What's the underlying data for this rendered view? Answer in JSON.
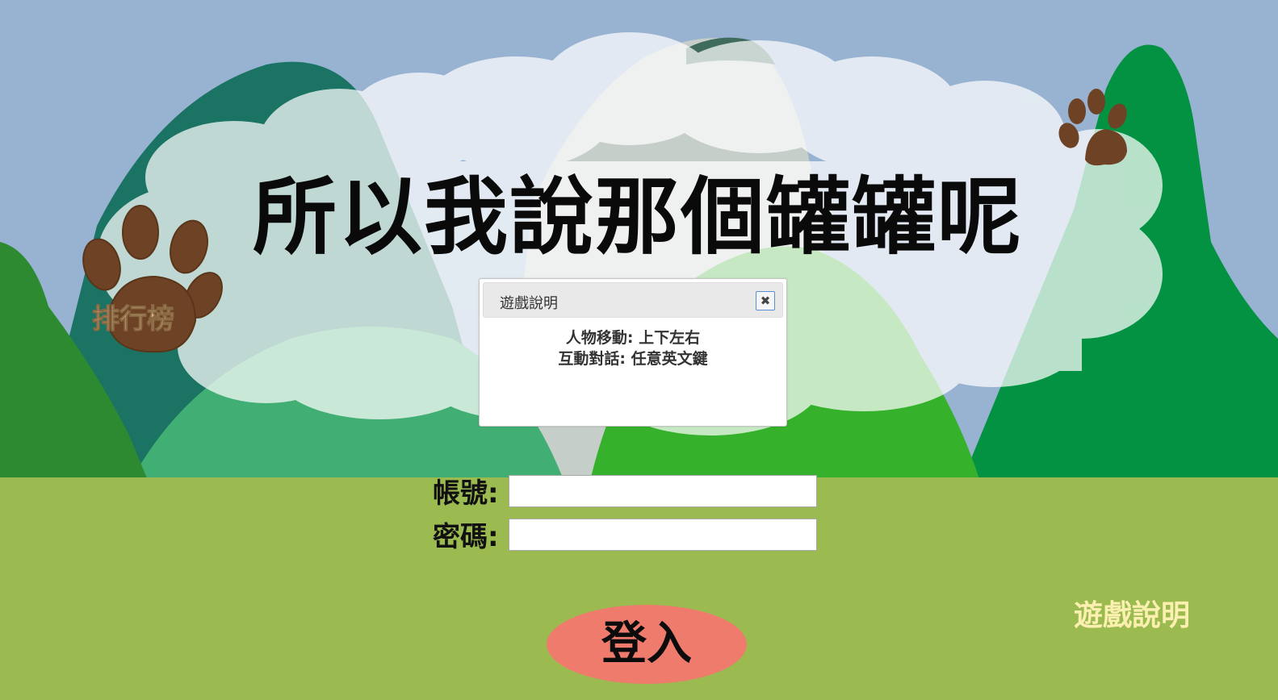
{
  "page": {
    "title": "所以我說那個罐罐呢"
  },
  "nav": {
    "leaderboard_label": "排行榜",
    "instructions_label": "遊戲說明"
  },
  "dialog": {
    "title": "遊戲說明",
    "close_icon": "close-icon",
    "lines": [
      "人物移動: 上下左右",
      "互動對話: 任意英文鍵"
    ]
  },
  "login_form": {
    "account_label": "帳號:",
    "account_value": "",
    "password_label": "密碼:",
    "password_value": "",
    "submit_label": "登入"
  },
  "colors": {
    "sky": "#97b3d1",
    "grass": "#9bbb51",
    "paw": "#6e4325",
    "login_button": "#ef7b6d",
    "instructions_text": "#fcf0b0",
    "leaderboard_text": "#d9b78b"
  }
}
